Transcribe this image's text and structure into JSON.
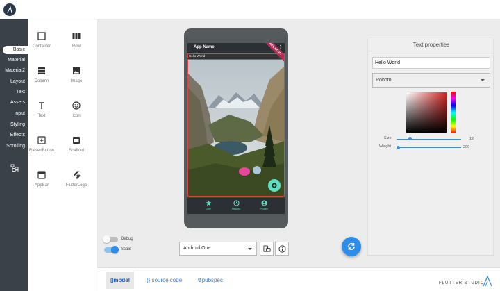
{
  "left_nav": {
    "items": [
      {
        "label": "Basic",
        "active": true
      },
      {
        "label": "Material",
        "active": false
      },
      {
        "label": "Material2",
        "active": false
      },
      {
        "label": "Layout",
        "active": false
      },
      {
        "label": "Text",
        "active": false
      },
      {
        "label": "Assets",
        "active": false
      },
      {
        "label": "Input",
        "active": false
      },
      {
        "label": "Styling",
        "active": false
      },
      {
        "label": "Effects",
        "active": false
      },
      {
        "label": "Scrolling",
        "active": false
      }
    ],
    "tree_icon": "widget-tree-icon"
  },
  "palette": {
    "items": [
      {
        "label": "Container",
        "icon": "container-icon"
      },
      {
        "label": "Row",
        "icon": "row-icon"
      },
      {
        "label": "Column",
        "icon": "column-icon"
      },
      {
        "label": "Image",
        "icon": "image-icon"
      },
      {
        "label": "Text",
        "icon": "text-icon"
      },
      {
        "label": "Icon",
        "icon": "smiley-icon"
      },
      {
        "label": "RaisedButton",
        "icon": "plus-box-icon"
      },
      {
        "label": "Scaffold",
        "icon": "scaffold-icon"
      },
      {
        "label": "AppBar",
        "icon": "appbar-icon"
      },
      {
        "label": "FlutterLogo",
        "icon": "flutter-logo-icon"
      }
    ]
  },
  "preview": {
    "app_title": "App Name",
    "ribbon": "WEB MODE",
    "selected_text": "Hello World",
    "fab_icon": "add-icon",
    "bottom_nav": [
      {
        "label": "Like",
        "icon": "star-icon"
      },
      {
        "label": "History",
        "icon": "clock-icon"
      },
      {
        "label": "Profile",
        "icon": "profile-icon"
      }
    ]
  },
  "toggles": {
    "debug": {
      "label": "Debug",
      "on": false
    },
    "scale": {
      "label": "Scale",
      "on": true
    }
  },
  "device": {
    "selected": "Android One"
  },
  "properties": {
    "title": "Text properties",
    "text_value": "Hello World",
    "font": "Roboto",
    "size_label": "Size",
    "size_value": "12",
    "weight_label": "Weight",
    "weight_value": "200",
    "accent_color": "#d32626"
  },
  "bottom_tabs": {
    "model": "model",
    "source": "{} source code",
    "pubspec": "pubspec"
  },
  "brand": "FLUTTER STUDIO",
  "colors": {
    "accent": "#2d8de8",
    "nav_bg": "#3b4148",
    "teal": "#5ee0c0"
  }
}
